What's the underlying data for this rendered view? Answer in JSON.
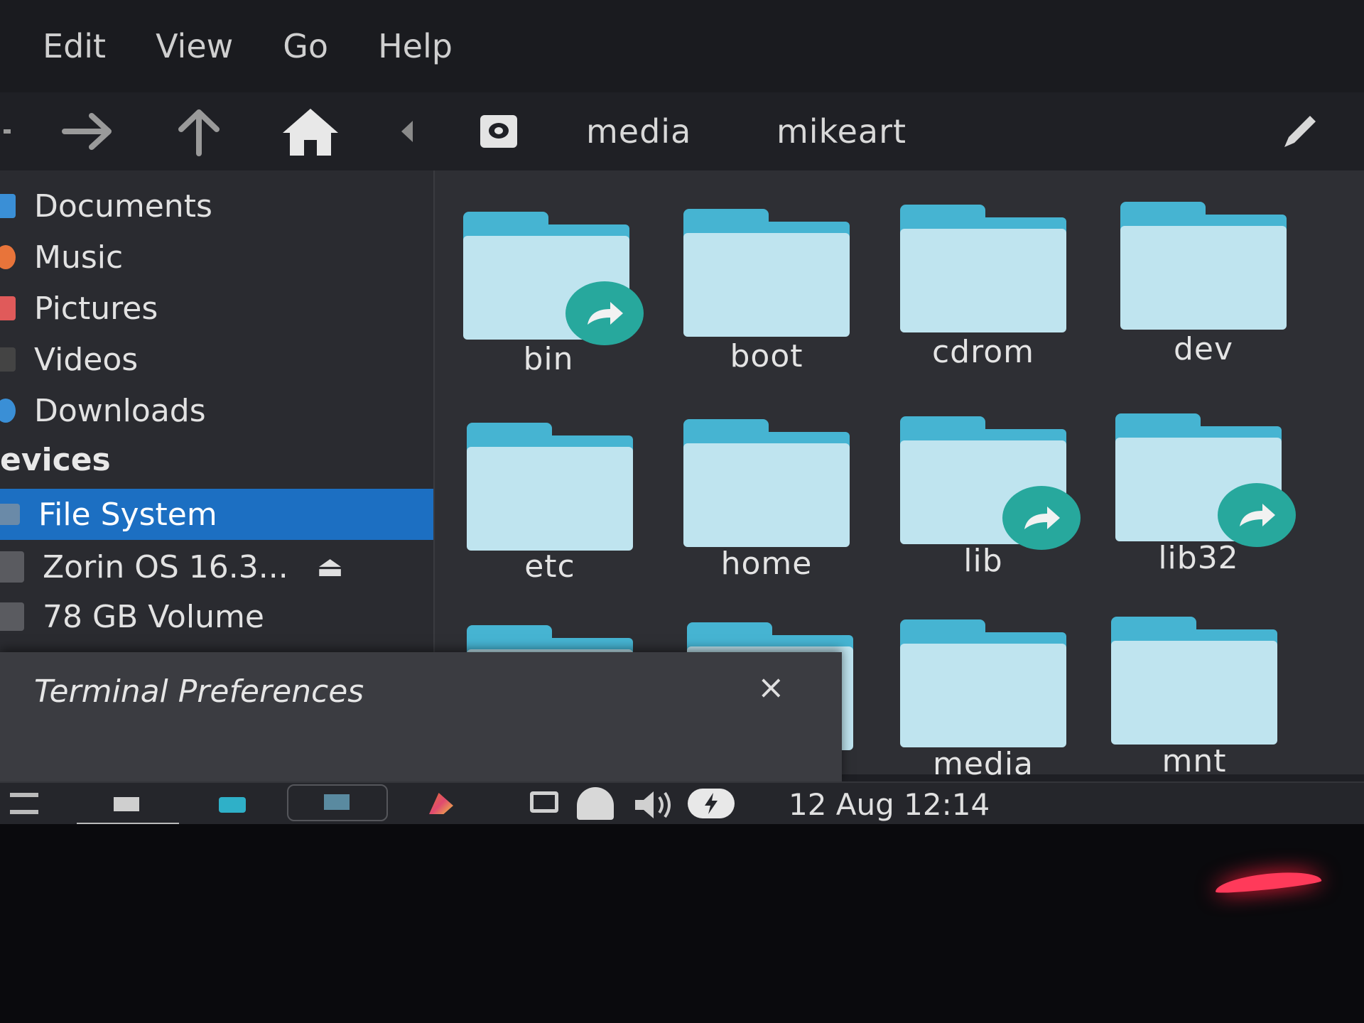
{
  "menubar": {
    "items": [
      "Edit",
      "View",
      "Go",
      "Help"
    ]
  },
  "toolbar": {
    "icons": [
      "back-icon",
      "forward-arrow-icon",
      "up-arrow-icon",
      "home-icon",
      "left-chevron-icon",
      "drive-icon",
      "pencil-icon"
    ],
    "breadcrumbs": [
      "media",
      "mikeart"
    ]
  },
  "sidebar": {
    "places": [
      {
        "label": "Documents",
        "color": "#3a8fd6"
      },
      {
        "label": "Music",
        "color": "#e8743a"
      },
      {
        "label": "Pictures",
        "color": "#e05a5a"
      },
      {
        "label": "Videos",
        "color": "#444444"
      },
      {
        "label": "Downloads",
        "color": "#3a8fd6"
      }
    ],
    "devices_header": "evices",
    "devices": [
      {
        "label": "File System",
        "selected": true
      },
      {
        "label": "Zorin OS 16.3...",
        "eject": "⏏"
      },
      {
        "label": "78 GB Volume"
      }
    ]
  },
  "folders": [
    {
      "name": "bin",
      "symlink": true
    },
    {
      "name": "boot",
      "symlink": false
    },
    {
      "name": "cdrom",
      "symlink": false
    },
    {
      "name": "dev",
      "symlink": false
    },
    {
      "name": "etc",
      "symlink": false
    },
    {
      "name": "home",
      "symlink": false
    },
    {
      "name": "lib",
      "symlink": true
    },
    {
      "name": "lib32",
      "symlink": true
    },
    {
      "name": "media",
      "symlink": false
    },
    {
      "name": "mnt",
      "symlink": false
    }
  ],
  "dialog": {
    "title": "Terminal Preferences",
    "close": "×"
  },
  "taskbar": {
    "clock": "12 Aug 12:14"
  },
  "colors": {
    "accent": "#1c6fc2",
    "folder_tab": "#46b4d2",
    "folder_body": "#bfe4ef",
    "symlink": "#27a89d"
  }
}
